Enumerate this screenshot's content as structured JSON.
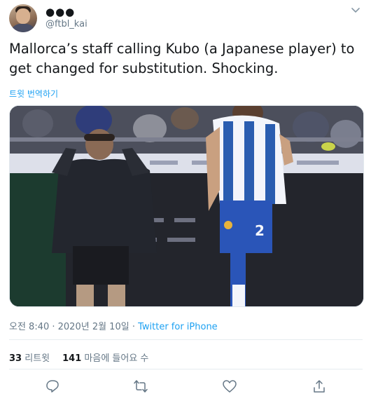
{
  "tweet": {
    "display_name": "●●●",
    "username": "@ftbl_kai",
    "text": "Mallorca’s staff calling Kubo (a Japanese player) to get changed for substitution. Shocking.",
    "translate_label": "트윗 번역하기",
    "timestamp": "오전 8:40 · 2020년 2월 10일 · ",
    "source": "Twitter for iPhone"
  },
  "stats": {
    "retweets_count": "33",
    "retweets_label": "리트윗",
    "likes_count": "141",
    "likes_label": "마음에 들어요 수"
  },
  "icons": {
    "more": "chevron-down-icon",
    "reply": "reply-icon",
    "retweet": "retweet-icon",
    "like": "heart-icon",
    "share": "share-icon"
  },
  "colors": {
    "link": "#1da1f2",
    "secondary_text": "#657786",
    "primary_text": "#14171a"
  }
}
